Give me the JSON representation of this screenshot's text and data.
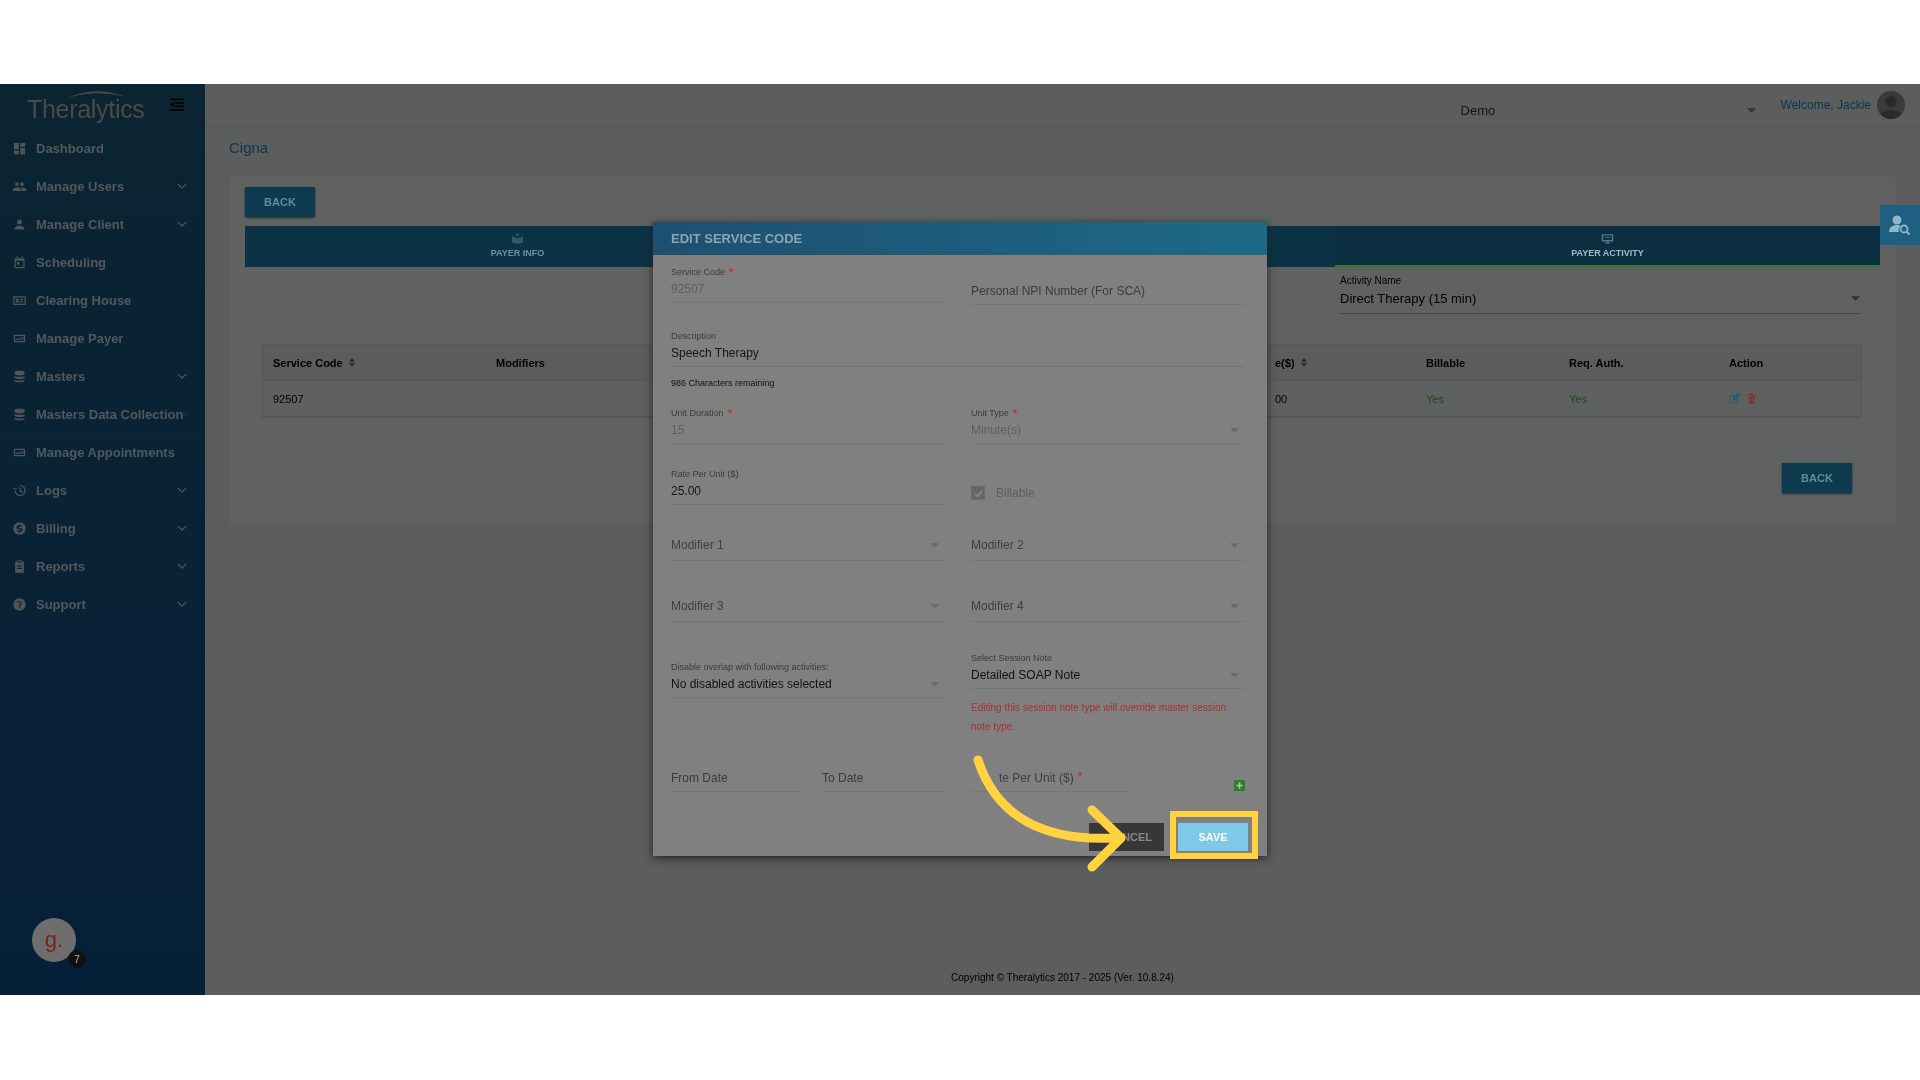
{
  "sidebar": {
    "logo": "Thera**lytics**",
    "items": [
      {
        "label": "Dashboard",
        "expandable": false
      },
      {
        "label": "Manage Users",
        "expandable": true
      },
      {
        "label": "Manage Client",
        "expandable": true
      },
      {
        "label": "Scheduling",
        "expandable": false
      },
      {
        "label": "Clearing House",
        "expandable": false
      },
      {
        "label": "Manage Payer",
        "expandable": false
      },
      {
        "label": "Masters",
        "expandable": true
      },
      {
        "label": "Masters Data Collection",
        "expandable": true
      },
      {
        "label": "Manage Appointments",
        "expandable": false
      },
      {
        "label": "Logs",
        "expandable": true
      },
      {
        "label": "Billing",
        "expandable": true
      },
      {
        "label": "Reports",
        "expandable": true
      },
      {
        "label": "Support",
        "expandable": true
      }
    ],
    "helper": {
      "letter": "g.",
      "badge": "7"
    }
  },
  "header": {
    "organization": "Demo",
    "welcome": "Welcome, Jackie"
  },
  "page": {
    "title": "Cigna",
    "back_button": "BACK",
    "tabs": [
      {
        "label": "PAYER INFO",
        "selected": false
      },
      {
        "label": "PAYER ACTIVITY",
        "selected": true
      }
    ],
    "activity_field": {
      "label": "Activity Name",
      "value": "Direct Therapy (15 min)"
    },
    "table": {
      "columns": [
        {
          "label": "Service Code",
          "sortable": true
        },
        {
          "label": "Modifiers",
          "sortable": false
        },
        {
          "label": "e($)",
          "sortable": true
        },
        {
          "label": "Billable",
          "sortable": false
        },
        {
          "label": "Req. Auth.",
          "sortable": false
        },
        {
          "label": "Action",
          "sortable": false
        }
      ],
      "rows": [
        {
          "service_code": "92507",
          "column_3": "00",
          "billable": "Yes",
          "req_auth": "Yes"
        }
      ]
    },
    "bottom_back_button": "BACK"
  },
  "footer": "Copyright © Theralytics 2017 - 2025 (Ver. 10.8.24)",
  "dialog": {
    "title": "EDIT SERVICE CODE",
    "service_code": {
      "label": "Service Code",
      "required": true,
      "value": "92507",
      "disabled": true
    },
    "npi": {
      "placeholder": "Personal NPI Number (For SCA)"
    },
    "description": {
      "label": "Description",
      "value": "Speech Therapy"
    },
    "chars_remaining": "986 Characters remaining",
    "unit_duration": {
      "label": "Unit Duration",
      "required": true,
      "value": "15",
      "disabled": true
    },
    "unit_type": {
      "label": "Unit Type",
      "required": true,
      "value": "Minute(s)",
      "disabled": true
    },
    "rate": {
      "label": "Rate Per Unit ($)",
      "value": "25.00"
    },
    "billable": {
      "label": "Billable",
      "checked": true
    },
    "modifiers": [
      {
        "placeholder": "Modifier 1"
      },
      {
        "placeholder": "Modifier 2"
      },
      {
        "placeholder": "Modifier 3"
      },
      {
        "placeholder": "Modifier 4"
      }
    ],
    "overlap": {
      "label": "Disable overlap with following activities:",
      "value": "No disabled activities selected"
    },
    "session_note": {
      "label": "Select Session Note",
      "value": "Detailed SOAP Note",
      "warning": "Editing this session note type will override master session note type."
    },
    "from_date": {
      "placeholder": "From Date"
    },
    "to_date": {
      "placeholder": "To Date"
    },
    "rate_row": {
      "placeholder": "te Per Unit ($)",
      "required": true
    },
    "cancel_button": "NCEL",
    "save_button": "SAVE"
  }
}
